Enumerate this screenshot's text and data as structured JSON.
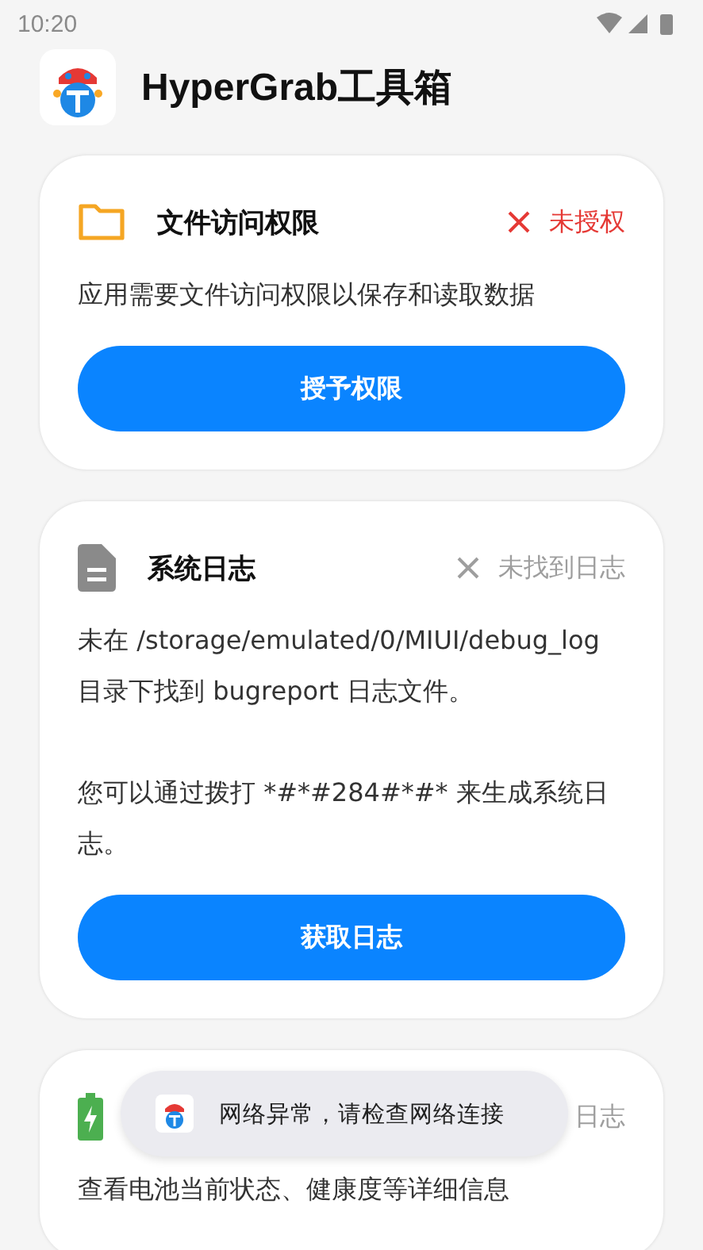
{
  "status_bar": {
    "time": "10:20"
  },
  "header": {
    "title": "HyperGrab工具箱"
  },
  "cards": [
    {
      "kind": "folder",
      "title": "文件访问权限",
      "status": {
        "kind": "denied",
        "cross": true,
        "text": "未授权"
      },
      "paragraphs": [
        "应用需要文件访问权限以保存和读取数据"
      ],
      "button": "授予权限"
    },
    {
      "kind": "document",
      "title": "系统日志",
      "status": {
        "kind": "missing",
        "cross": true,
        "text": "未找到日志"
      },
      "paragraphs": [
        "未在 /storage/emulated/0/MIUI/debug_log 目录下找到 bugreport 日志文件。",
        "您可以通过拨打 *#*#284#*#* 来生成系统日志。"
      ],
      "button": "获取日志"
    },
    {
      "kind": "battery",
      "status": {
        "kind": "missing",
        "cross": false,
        "text": "日志"
      },
      "paragraphs": [
        "查看电池当前状态、健康度等详细信息"
      ]
    }
  ],
  "toast": {
    "text": "网络异常，请检查网络连接"
  }
}
